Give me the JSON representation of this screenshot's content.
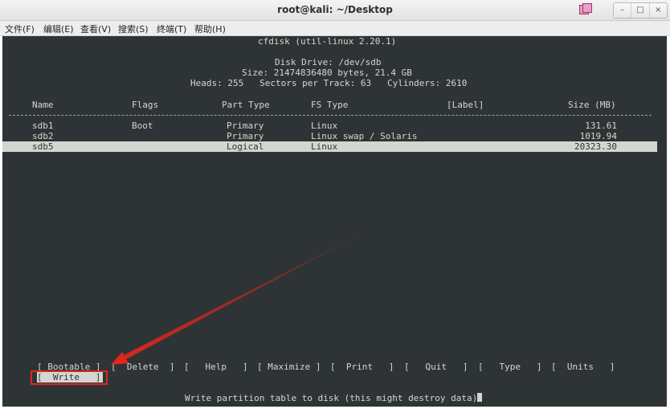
{
  "window": {
    "title": "root@kali: ~/Desktop"
  },
  "window_buttons": {
    "minimize": "–",
    "maximize": "□",
    "close": "×"
  },
  "menu": [
    "文件(F)",
    "编辑(E)",
    "查看(V)",
    "搜索(S)",
    "终端(T)",
    "帮助(H)"
  ],
  "header": {
    "program": "cfdisk (util-linux 2.20.1)",
    "disk_drive": "Disk Drive: /dev/sdb",
    "size": "Size: 21474836480 bytes, 21.4 GB",
    "geometry": "Heads: 255   Sectors per Track: 63   Cylinders: 2610"
  },
  "table": {
    "headers": {
      "name": "Name",
      "flags": "Flags",
      "part_type": "Part Type",
      "fs_type": "FS Type",
      "label": "[Label]",
      "size": "Size (MB)"
    },
    "rows": [
      {
        "name": "sdb1",
        "flags": "Boot",
        "part_type": "Primary",
        "fs_type": "Linux",
        "label": "",
        "size": "131.61"
      },
      {
        "name": "sdb2",
        "flags": "",
        "part_type": "Primary",
        "fs_type": "Linux swap / Solaris",
        "label": "",
        "size": "1019.94"
      },
      {
        "name": "sdb5",
        "flags": "",
        "part_type": "Logical",
        "fs_type": "Linux",
        "label": "",
        "size": "20323.30"
      }
    ],
    "selected_marker": "*"
  },
  "actions": {
    "bootable": "[ Bootable ]",
    "delete": "[  Delete  ]",
    "help": "[   Help   ]",
    "maximize": "[ Maximize ]",
    "print": "[  Print   ]",
    "quit": "[   Quit   ]",
    "type": "[   Type   ]",
    "units": "[  Units   ]",
    "write": "[  Write   ]"
  },
  "status": "Write partition table to disk (this might destroy data)",
  "colors": {
    "terminal_bg": "#2e3436",
    "terminal_fg": "#d3d7cf",
    "annotation": "#e0261e"
  }
}
